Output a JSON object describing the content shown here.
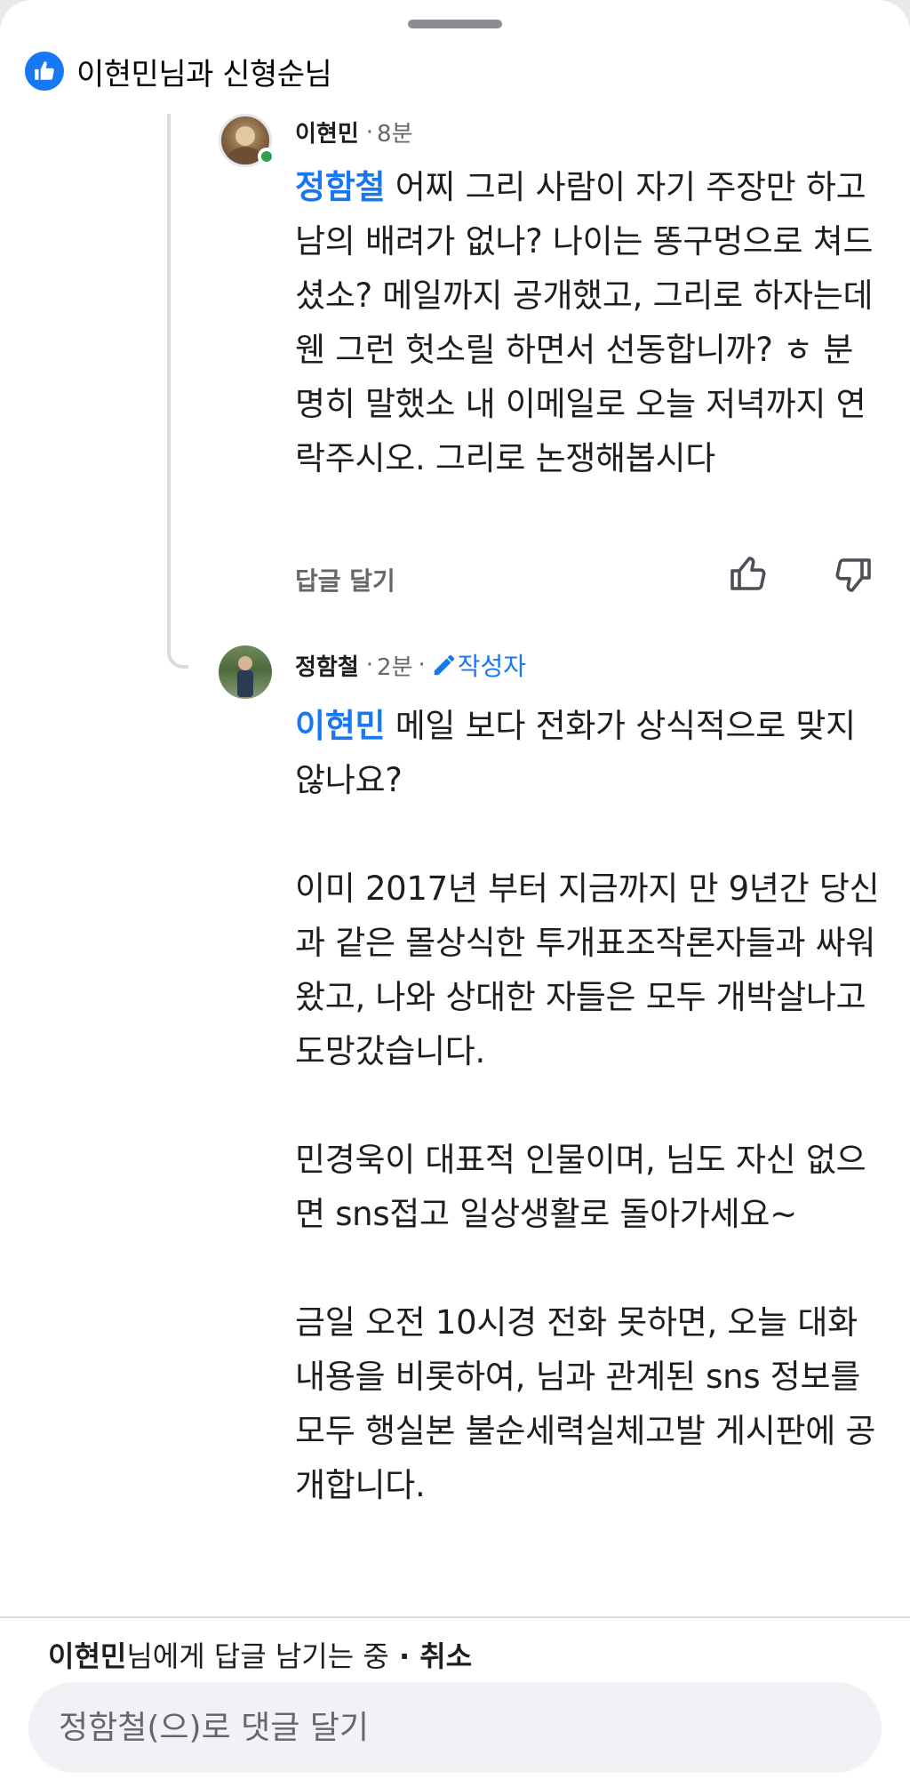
{
  "header": {
    "title": "이현민님과 신형순님"
  },
  "comments": [
    {
      "author": "이현민",
      "time": "8분",
      "mention": "정함철",
      "text": " 어찌 그리 사람이 자기 주장만 하고 남의 배려가 없나? 나이는 똥구멍으로 쳐드셨소? 메일까지 공개했고, 그리로 하자는데 웬 그런 헛소릴 하면서 선동합니까? ㅎ 분명히 말했소 내 이메일로 오늘 저녁까지 연락주시오. 그리로 논쟁해봅시다",
      "reply_label": "답글 달기"
    },
    {
      "author": "정함철",
      "time": "2분",
      "badge": "작성자",
      "mention": "이현민",
      "paragraphs": [
        " 메일 보다 전화가 상식적으로 맞지 않나요?",
        "이미 2017년 부터 지금까지 만 9년간 당신과 같은 몰상식한 투개표조작론자들과 싸워왔고, 나와 상대한 자들은 모두 개박살나고 도망갔습니다.",
        "민경욱이 대표적 인물이며, 님도 자신 없으면 sns접고 일상생활로 돌아가세요~",
        "금일 오전 10시경 전화 못하면, 오늘 대화내용을 비롯하여, 님과 관계된 sns 정보를 모두 행실본 불순세력실체고발 게시판에 공개합니다."
      ]
    }
  ],
  "reply_bar": {
    "target": "이현민",
    "suffix": "님에게 답글 남기는 중",
    "dot": " · ",
    "cancel": "취소"
  },
  "composer": {
    "placeholder": "정함철(으)로 댓글 달기"
  },
  "colors": {
    "accent": "#1877f2",
    "online": "#31a24c"
  },
  "icons": [
    "thumbs-up-icon",
    "thumbs-down-icon",
    "pencil-icon",
    "like-badge-icon"
  ]
}
